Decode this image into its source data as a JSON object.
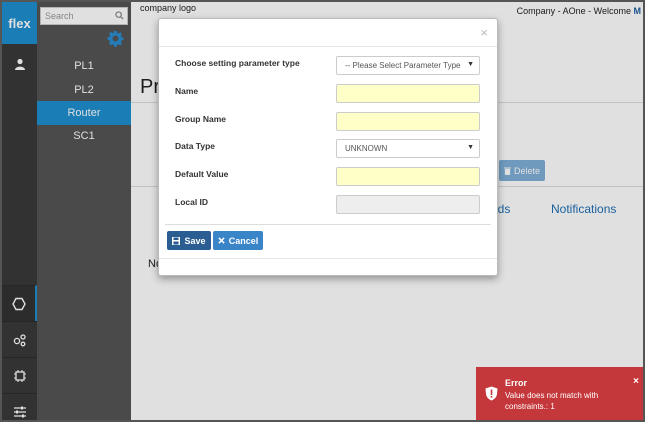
{
  "sidebar": {
    "brand": "flex",
    "search_placeholder": "Search",
    "items": [
      {
        "label": "PL1"
      },
      {
        "label": "PL2"
      },
      {
        "label": "Router"
      },
      {
        "label": "SC1"
      }
    ],
    "active_item": "Router"
  },
  "header": {
    "logo_text": "company logo",
    "user_text": "Company - AOne - Welcome",
    "user_initial": "M"
  },
  "background": {
    "heading_fragment": "Pr",
    "delete_label": "Delete",
    "tab_ids_fragment": "lds",
    "tab_notifications": "Notifications",
    "text_fragment_1": "(",
    "text_fragment_2": "No"
  },
  "modal": {
    "close_glyph": "×",
    "fields": {
      "param_type_label": "Choose setting parameter type",
      "param_type_value": "-- Please Select Parameter Type",
      "name_label": "Name",
      "name_value": "",
      "group_label": "Group Name",
      "group_value": "",
      "datatype_label": "Data Type",
      "datatype_value": "UNKNOWN",
      "default_label": "Default Value",
      "default_value": "",
      "localid_label": "Local ID",
      "localid_value": ""
    },
    "save_label": "Save",
    "cancel_label": "Cancel"
  },
  "toast": {
    "title": "Error",
    "message": "Value does not match with constraints.: 1",
    "close_glyph": "×"
  },
  "colors": {
    "accent": "#1e8fd0",
    "save_button": "#2a5e93",
    "cancel_button": "#3a84c8",
    "error": "#c4383c",
    "input_highlight": "#ffffc8"
  }
}
